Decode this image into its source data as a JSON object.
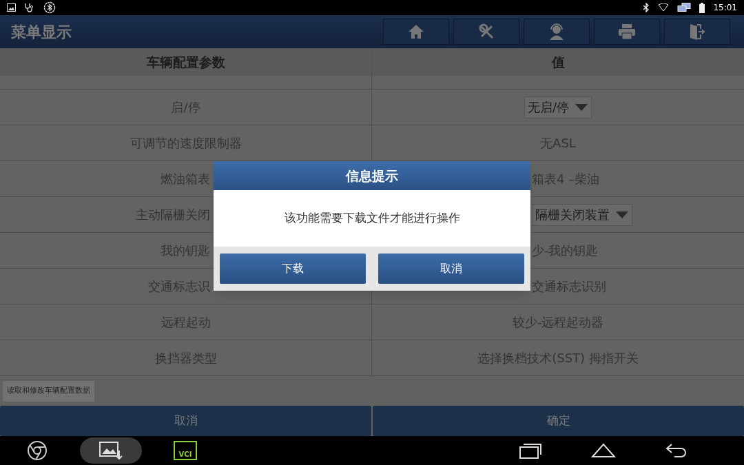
{
  "status_bar": {
    "time": "15:01"
  },
  "header": {
    "title": "菜单显示"
  },
  "table": {
    "columns": [
      "车辆配置参数",
      "值"
    ],
    "rows": [
      {
        "parameter": "启/停",
        "parameter_covered": false,
        "value": "无启/停",
        "kind": "dropdown",
        "value_covered": false
      },
      {
        "parameter": "可调节的速度限制器",
        "parameter_covered": false,
        "value": "无ASL",
        "kind": "text",
        "value_covered": false
      },
      {
        "parameter": "燃油箱表",
        "parameter_covered": true,
        "value": "箱表4 –柴油",
        "kind": "text",
        "value_covered": true
      },
      {
        "parameter": "主动隔栅关闭",
        "parameter_covered": true,
        "value": "隔栅关闭装置",
        "kind": "dropdown",
        "value_covered": true
      },
      {
        "parameter": "我的钥匙",
        "parameter_covered": true,
        "value": "少-我的钥匙",
        "kind": "text",
        "value_covered": true
      },
      {
        "parameter": "交通标志识",
        "parameter_covered": true,
        "value": "交通标志识别",
        "kind": "text",
        "value_covered": true
      },
      {
        "parameter": "远程起动",
        "parameter_covered": false,
        "value": "较少-远程起动器",
        "kind": "text",
        "value_covered": false
      },
      {
        "parameter": "换挡器类型",
        "parameter_covered": false,
        "value": "选择换档技术(SST) 拇指开关",
        "kind": "text",
        "value_covered": false
      }
    ]
  },
  "read_modify_button": "读取和修改车辆配置数据",
  "footer_buttons": [
    "取消",
    "确定"
  ],
  "dialog": {
    "title": "信息提示",
    "message": "该功能需要下载文件才能进行操作",
    "buttons": [
      "下载",
      "取消"
    ]
  },
  "nav_bar": {
    "vci_label": "VCI"
  }
}
